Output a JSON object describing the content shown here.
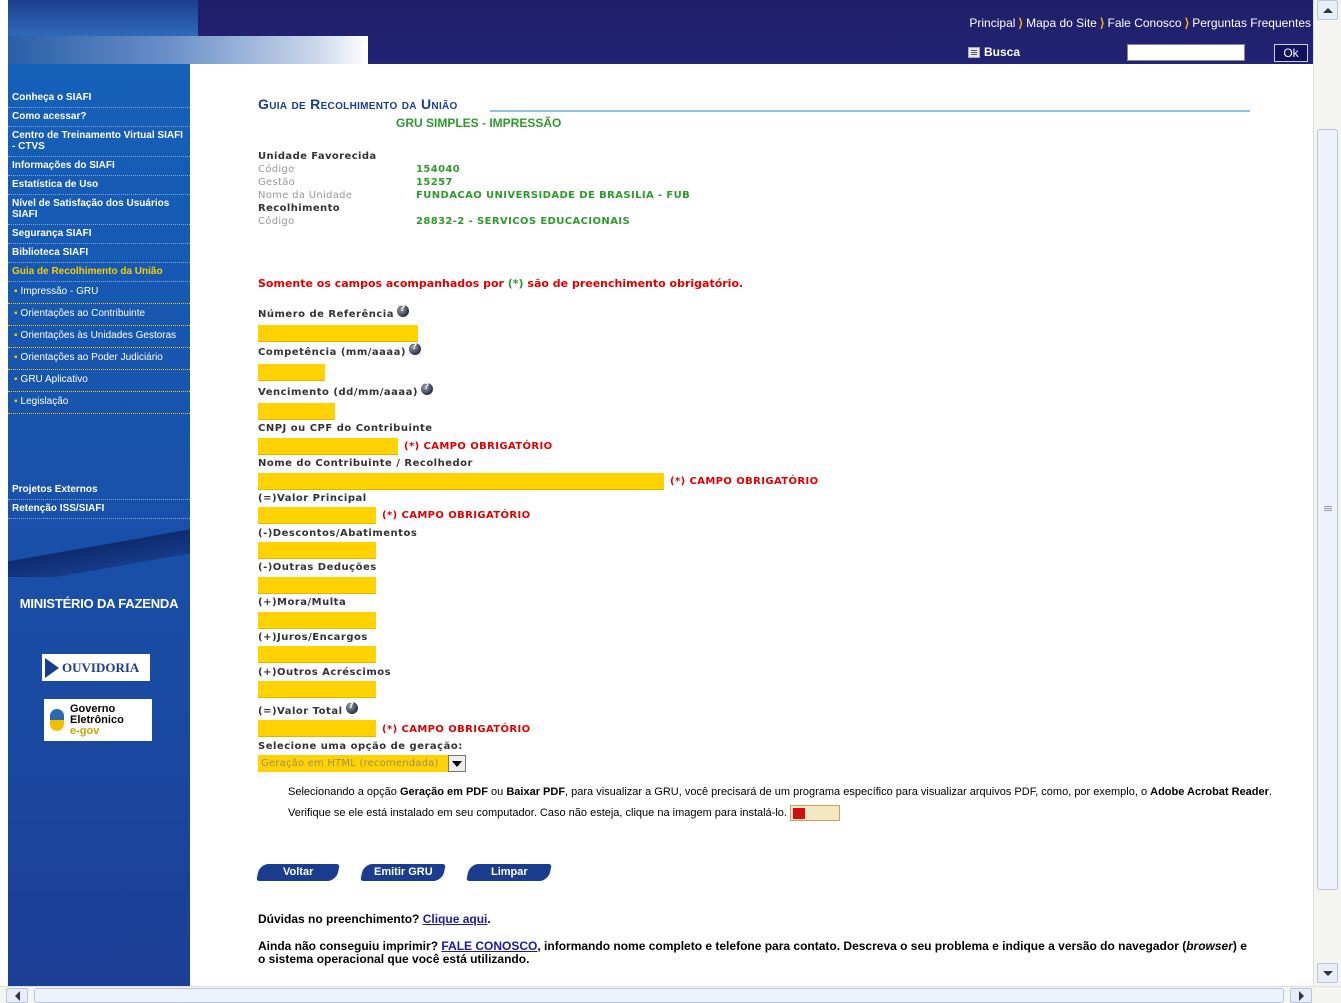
{
  "header": {
    "nav": [
      {
        "label": "Principal"
      },
      {
        "label": "Mapa do Site"
      },
      {
        "label": "Fale Conosco"
      },
      {
        "label": "Perguntas Frequentes"
      }
    ],
    "search_label": "Busca",
    "search_button": "Ok",
    "colors": {
      "bar": "#232377",
      "accent": "#f5b800"
    }
  },
  "sidebar": {
    "items": [
      {
        "label": "Conheça o SIAFI"
      },
      {
        "label": "Como acessar?"
      },
      {
        "label": "Centro de Treinamento Virtual SIAFI - CTVS"
      },
      {
        "label": "Informações do SIAFI"
      },
      {
        "label": "Estatística de Uso"
      },
      {
        "label": "Nível de Satisfação dos Usuários SIAFI"
      },
      {
        "label": "Segurança SIAFI"
      },
      {
        "label": "Biblioteca SIAFI"
      },
      {
        "label": "Guia de Recolhimento da União"
      }
    ],
    "subitems": [
      {
        "label": "Impressão - GRU"
      },
      {
        "label": "Orientações ao Contribuinte"
      },
      {
        "label": "Orientações às Unidades Gestoras"
      },
      {
        "label": "Orientações ao Poder Judiciário"
      },
      {
        "label": "GRU Aplicativo"
      },
      {
        "label": "Legislação"
      }
    ],
    "items2": [
      {
        "label": "Projetos Externos"
      },
      {
        "label": "Retenção ISS/SIAFI"
      }
    ],
    "ministry": "MINISTÉRIO DA FAZENDA",
    "ouvidoria": "OUVIDORIA",
    "egov": {
      "line1": "Governo",
      "line2": "Eletrônico",
      "line3": "e-gov"
    }
  },
  "main": {
    "title": "Guia de Recolhimento da União",
    "subtitle": "GRU SIMPLES - IMPRESSÃO",
    "unidade_head": "Unidade Favorecida",
    "codigo_label": "Código",
    "codigo_value": "154040",
    "gestao_label": "Gestão",
    "gestao_value": "15257",
    "nome_label": "Nome da Unidade",
    "nome_value": "FUNDACAO UNIVERSIDADE DE BRASILIA - FUB",
    "recolhimento_head": "Recolhimento",
    "rec_codigo_label": "Código",
    "rec_codigo_value": "28832-2 - SERVICOS EDUCACIONAIS",
    "warning_before": "Somente os campos acompanhados por ",
    "warning_ast": "(*)",
    "warning_after": " são de preenchimento obrigatório."
  },
  "form": {
    "referencia": "Número de Referência",
    "competencia": "Competência (mm/aaaa)",
    "vencimento": "Vencimento (dd/mm/aaaa)",
    "cnpj": "CNPJ ou CPF do Contribuinte",
    "nome": "Nome do Contribuinte / Recolhedor",
    "valor_principal": "(=)Valor Principal",
    "descontos": "(-)Descontos/Abatimentos",
    "outras_deducoes": "(-)Outras Deduções",
    "mora": "(+)Mora/Multa",
    "juros": "(+)Juros/Encargos",
    "outros_acrescimos": "(+)Outros Acréscimos",
    "valor_total": "(=)Valor Total",
    "required": "(*) CAMPO OBRIGATÓRIO",
    "generation_label": "Selecione uma opção de geração:",
    "generation_value": "Geração em HTML (recomendada)"
  },
  "note": {
    "p1_a": "Selecionando a opção ",
    "p1_b": "Geração em PDF",
    "p1_c": " ou ",
    "p1_d": "Baixar PDF",
    "p1_e": ", para visualizar a GRU, você precisará de um programa específico para visualizar arquivos PDF, como, por exemplo, o ",
    "p1_f": "Adobe Acrobat Reader",
    "p1_g": ".",
    "p2": "Verifique se ele está instalado em seu computador. Caso não esteja, clique na imagem para instalá-lo."
  },
  "buttons": {
    "voltar": "Voltar",
    "emitir": "Emitir GRU",
    "limpar": "Limpar"
  },
  "footer": {
    "help_text": "Dúvidas no preenchimento? ",
    "help_link": "Clique aqui",
    "help_end": ".",
    "contact_a": "Ainda não conseguiu imprimir? ",
    "contact_link": "FALE CONOSCO",
    "contact_b": ", informando nome completo e telefone para contato.  Descreva o seu problema e indique a versão do navegador (",
    "contact_browser": "browser",
    "contact_c": ") e o sistema operacional que você está utilizando."
  }
}
